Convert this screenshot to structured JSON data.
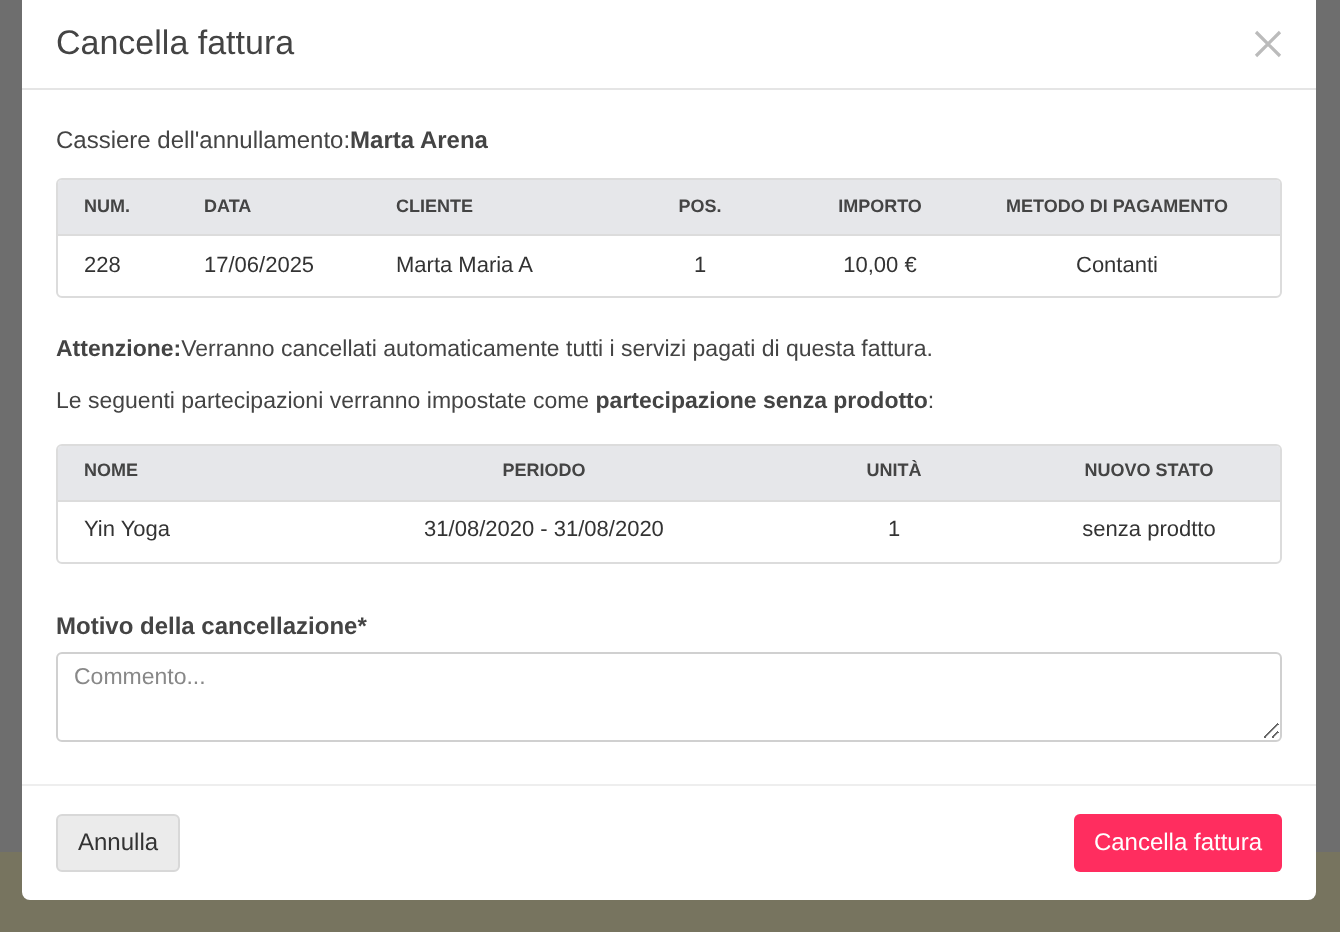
{
  "dialog": {
    "title": "Cancella fattura",
    "cashier": {
      "label": "Cassiere dell'annullamento:",
      "value": "Marta Arena"
    },
    "invoice_table": {
      "columns": [
        "NUM.",
        "DATA",
        "CLIENTE",
        "POS.",
        "IMPORTO",
        "METODO DI PAGAMENTO"
      ],
      "rows": [
        [
          "228",
          "17/06/2025",
          "Marta Maria A",
          "1",
          "10,00 €",
          "Contanti"
        ]
      ]
    },
    "warning": "**Attenzione:**Verranno cancellati automaticamente tutti i servizi pagati di questa fattura.",
    "note": "Le seguenti partecipazioni verranno impostate come **partecipazione senza prodotto**:",
    "participation_table": {
      "columns": [
        "NOME",
        "PERIODO",
        "UNITÀ",
        "NUOVO STATO"
      ],
      "rows": [
        [
          "Yin Yoga",
          "31/08/2020 - 31/08/2020",
          "1",
          "senza prodtto"
        ]
      ]
    },
    "reason": {
      "label": "Motivo della cancellazione*",
      "placeholder": "Commento..."
    },
    "buttons": [
      {
        "kind": "secondary",
        "label": "Annulla"
      },
      {
        "kind": "danger",
        "label": "Cancella fattura"
      }
    ]
  }
}
